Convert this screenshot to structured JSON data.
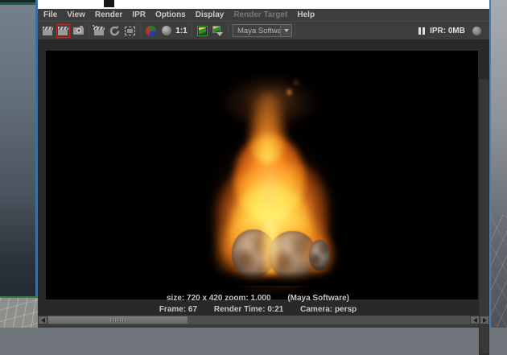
{
  "window": {
    "menubar": {
      "items": [
        {
          "label": "File"
        },
        {
          "label": "View"
        },
        {
          "label": "Render"
        },
        {
          "label": "IPR"
        },
        {
          "label": "Options"
        },
        {
          "label": "Display"
        },
        {
          "label": "Render Target",
          "disabled": true
        },
        {
          "label": "Help"
        }
      ]
    },
    "toolbar": {
      "buttons": [
        {
          "name": "render-icon"
        },
        {
          "name": "redo-previous-render-icon",
          "highlight": "#b83030"
        },
        {
          "name": "snapshot-icon"
        },
        {
          "name": "ipr-render-icon"
        },
        {
          "name": "refresh-ipr-icon"
        },
        {
          "name": "ipr-region-render-icon"
        },
        {
          "name": "rgb-channels-icon"
        },
        {
          "name": "alpha-channel-icon"
        },
        {
          "name": "one-to-one-button",
          "label": "1:1"
        },
        {
          "name": "keep-image-icon",
          "highlight": "#3c9a3c"
        },
        {
          "name": "remove-image-icon"
        }
      ],
      "renderer_dropdown": {
        "value": "Maya Software"
      },
      "pause_icon": "pause-ipr-icon",
      "ipr_memory": "IPR: 0MB",
      "status_sphere": "render-progress-sphere-icon"
    },
    "status": {
      "size_zoom": "size: 720 x 420 zoom: 1.000",
      "renderer": "(Maya Software)",
      "frame": "Frame: 67",
      "render_time": "Render Time: 0:21",
      "camera": "Camera: persp"
    },
    "render_image": {
      "subject": "fire-flames-over-glowing-rocks"
    },
    "colors": {
      "red_highlight": "#b83030",
      "green_highlight": "#3c9a3c",
      "menubar_bg": "#3d3d3d",
      "content_bg": "#292929",
      "viewport_border_blue": "#4b7fb1",
      "viewport_border_green": "#2f7a45"
    }
  }
}
